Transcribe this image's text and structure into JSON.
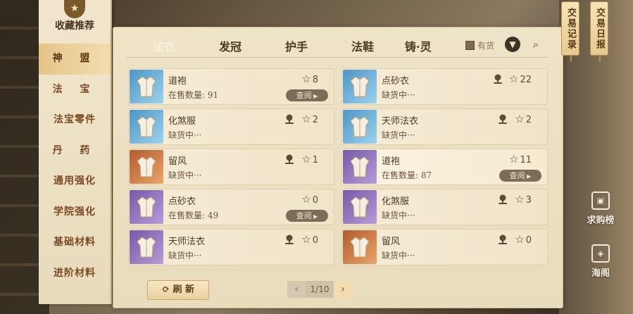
{
  "sidebar": {
    "title": "收藏推荐",
    "categories": [
      "神 盟",
      "法 宝",
      "法宝零件",
      "丹 药",
      "通用强化",
      "学院强化",
      "基础材料",
      "进阶材料"
    ]
  },
  "tabs": [
    "法衣",
    "发冠",
    "护手",
    "法鞋",
    "铸·灵"
  ],
  "filter": {
    "instock_label": "有货"
  },
  "items": [
    {
      "name": "道袍",
      "status": "在售数量: 91",
      "stars": "8",
      "view": "查阅",
      "color": "blue"
    },
    {
      "name": "点砂衣",
      "status": "缺货中···",
      "stars": "22",
      "color": "blue"
    },
    {
      "name": "化煞服",
      "status": "缺货中···",
      "stars": "2",
      "color": "blue"
    },
    {
      "name": "天师法衣",
      "status": "缺货中···",
      "stars": "2",
      "color": "blue"
    },
    {
      "name": "留风",
      "status": "缺货中···",
      "stars": "1",
      "color": "orange"
    },
    {
      "name": "道袍",
      "status": "在售数量: 87",
      "stars": "11",
      "view": "查阅",
      "color": "purple"
    },
    {
      "name": "点砂衣",
      "status": "在售数量: 49",
      "stars": "0",
      "view": "查阅",
      "color": "purple"
    },
    {
      "name": "化煞服",
      "status": "缺货中···",
      "stars": "3",
      "color": "purple"
    },
    {
      "name": "天师法衣",
      "status": "缺货中···",
      "stars": "0",
      "color": "purple"
    },
    {
      "name": "留风",
      "status": "缺货中···",
      "stars": "0",
      "color": "orange"
    }
  ],
  "footer": {
    "refresh": "刷 新",
    "page": "1/10"
  },
  "right": {
    "trade_record": "交易记录",
    "trade_daily": "交易日报",
    "wanted": "求购榜",
    "haige": "海阁"
  }
}
